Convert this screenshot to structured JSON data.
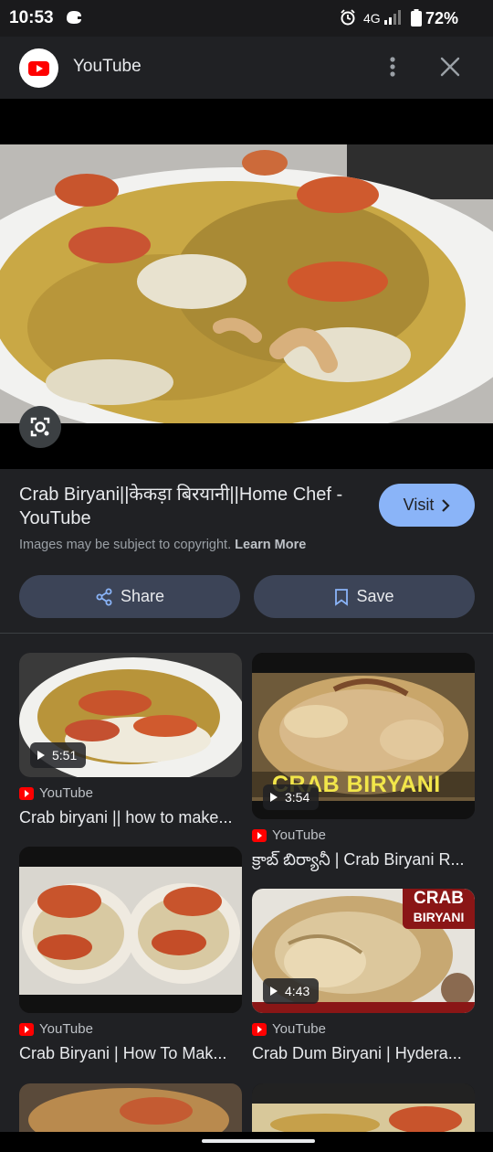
{
  "status_bar": {
    "time": "10:53",
    "network": "4G",
    "battery": "72%"
  },
  "header": {
    "title": "YouTube",
    "logo_icon": "youtube-logo-icon",
    "menu_icon": "more-vert-icon",
    "close_icon": "close-icon"
  },
  "result": {
    "title": "Crab Biryani||केकड़ा बिरयानी||Home Chef - YouTube",
    "visit_label": "Visit",
    "copyright_text": "Images may be subject to copyright.",
    "learn_more": "Learn More",
    "share_label": "Share",
    "save_label": "Save"
  },
  "related": [
    {
      "source": "YouTube",
      "title": "Crab biryani || how to make...",
      "duration": "5:51"
    },
    {
      "source": "YouTube",
      "title": "క్రాబ్ బిర్యానీ | Crab Biryani R...",
      "duration": "3:54",
      "overlay_text": "CRAB BIRYANI"
    },
    {
      "source": "YouTube",
      "title": "Crab Biryani | How To Mak...",
      "duration": ""
    },
    {
      "source": "YouTube",
      "title": "Crab Dum Biryani | Hydera...",
      "duration": "4:43",
      "overlay_text_1": "CRAB",
      "overlay_text_2": "BIRYANI"
    }
  ],
  "colors": {
    "background": "#202124",
    "accent_button": "#8ab4f8",
    "pill_background": "#3c4457",
    "youtube_red": "#ff0000"
  }
}
